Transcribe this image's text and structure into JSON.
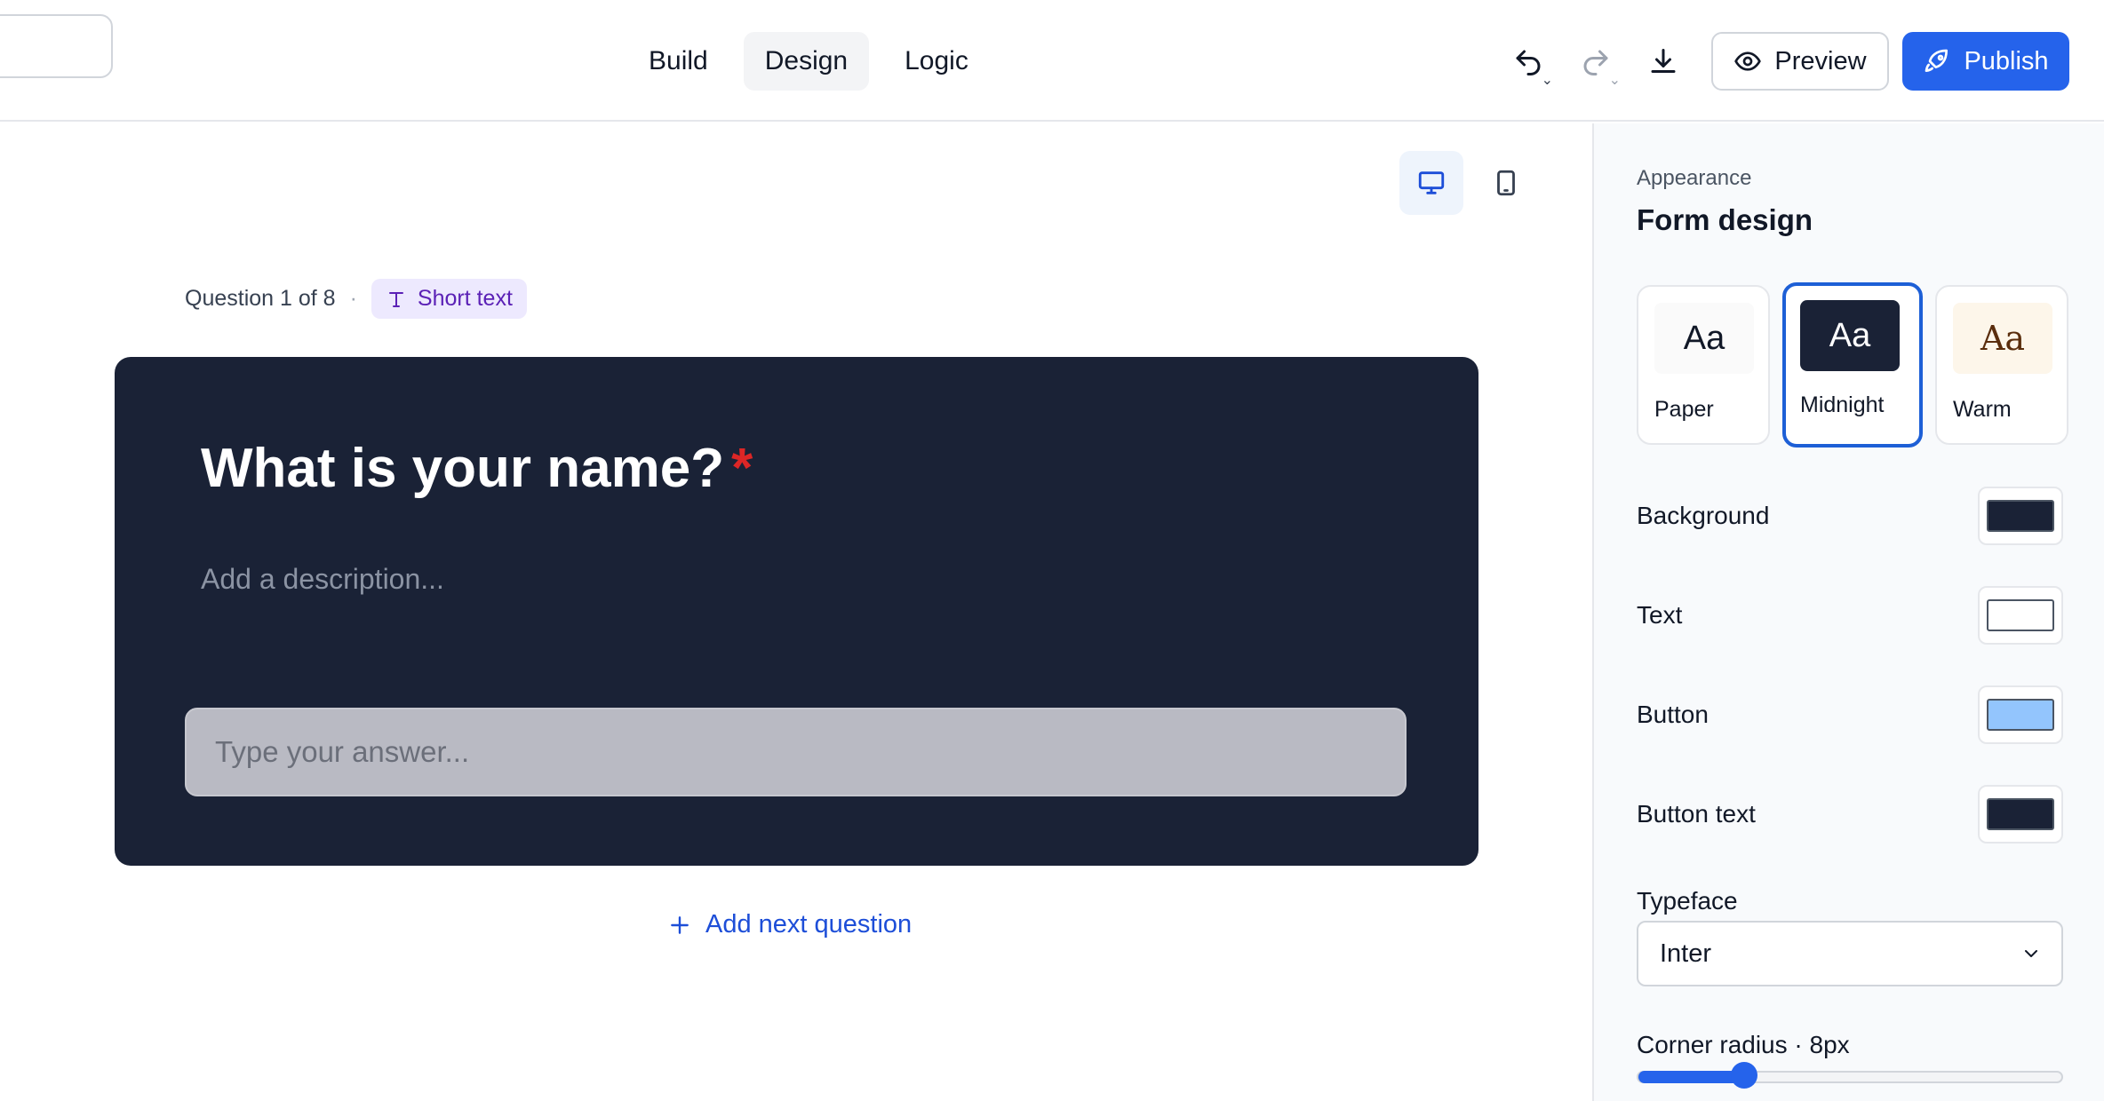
{
  "topbar": {
    "modes": [
      {
        "label": "Build",
        "active": false
      },
      {
        "label": "Design",
        "active": true
      },
      {
        "label": "Logic",
        "active": false
      }
    ],
    "icons": [
      "undo-icon",
      "redo-icon",
      "download-icon"
    ],
    "preview_label": "Preview",
    "publish_label": "Publish",
    "accent": "#2563eb"
  },
  "canvas": {
    "device_active": "desktop",
    "question_meta": "Question 1 of 8",
    "meta_separator": "·",
    "question_type": "Short text",
    "question_title": "What is your name?",
    "required_mark": "*",
    "description_placeholder": "Add a description...",
    "answer_placeholder": "Type your answer...",
    "add_next_label": "Add next question",
    "card_bg": "#1a2236"
  },
  "panel": {
    "eyebrow": "Appearance",
    "title": "Form design",
    "themes": [
      {
        "sample": "Aa",
        "name": "Paper",
        "selected": false
      },
      {
        "sample": "Aa",
        "name": "Midnight",
        "selected": true
      },
      {
        "sample": "Aa",
        "name": "Warm",
        "selected": false
      }
    ],
    "colors": [
      {
        "label": "Background",
        "value": "#1a2236"
      },
      {
        "label": "Text",
        "value": "#ffffff"
      },
      {
        "label": "Button",
        "value": "#93c5fd"
      },
      {
        "label": "Button text",
        "value": "#1a2236"
      }
    ],
    "typeface_label": "Typeface",
    "typeface_value": "Inter",
    "corner_radius_label": "Corner radius · 8px",
    "corner_radius_fraction": 0.25
  }
}
